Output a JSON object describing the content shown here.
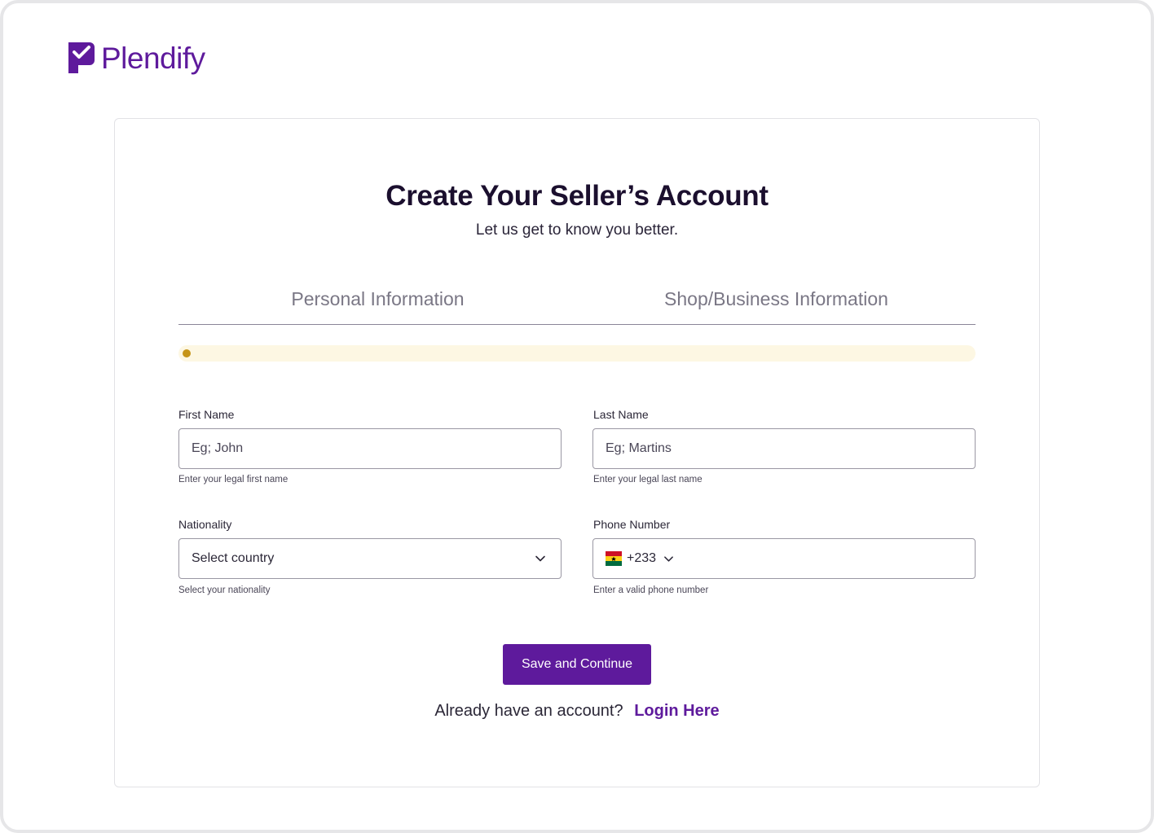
{
  "brand": {
    "name": "Plendify",
    "color": "#5e1a9c"
  },
  "header": {
    "title": "Create Your Seller’s Account",
    "subtitle": "Let us get to know you better."
  },
  "tabs": [
    {
      "label": "Personal Information"
    },
    {
      "label": "Shop/Business Information"
    }
  ],
  "progress": {
    "fraction": 0,
    "track_color": "#fdf7e3",
    "indicator_color": "#c59418"
  },
  "form": {
    "first_name": {
      "label": "First Name",
      "placeholder": "Eg; John",
      "value": "",
      "helper": "Enter your legal first name"
    },
    "last_name": {
      "label": "Last Name",
      "placeholder": "Eg; Martins",
      "value": "",
      "helper": "Enter your legal last name"
    },
    "nationality": {
      "label": "Nationality",
      "selected": "Select country",
      "helper": "Select your nationality",
      "icon": "chevron-down-icon"
    },
    "phone": {
      "label": "Phone Number",
      "dial_code": "+233",
      "country_flag_icon": "ghana-flag-icon",
      "value": "",
      "helper": "Enter a valid phone number"
    }
  },
  "actions": {
    "save_label": "Save and Continue",
    "login_prompt": "Already have an account?",
    "login_link": "Login Here"
  }
}
